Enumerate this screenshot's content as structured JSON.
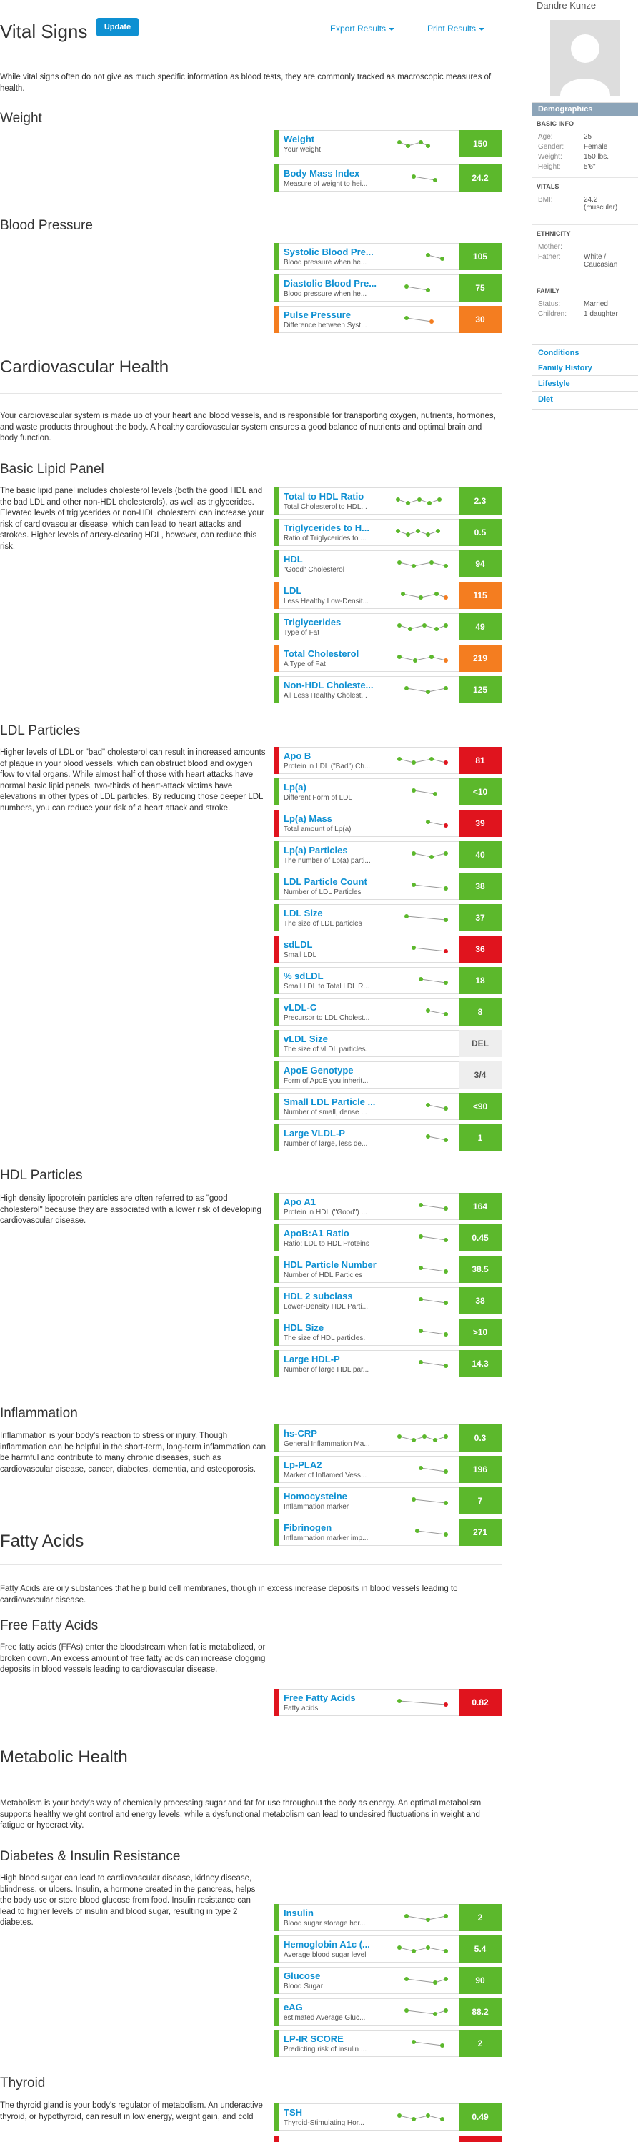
{
  "header": {
    "title": "Vital Signs",
    "update": "Update",
    "export": "Export Results",
    "print": "Print Results"
  },
  "intro": "While vital signs often do not give as much specific information as blood tests, they are commonly tracked as macroscopic measures of health.",
  "sidebar": {
    "name": "Dandre Kunze",
    "demographics": "Demographics",
    "basic_info": "BASIC INFO",
    "age_k": "Age:",
    "age_v": "25",
    "gender_k": "Gender:",
    "gender_v": "Female",
    "weight_k": "Weight:",
    "weight_v": "150 lbs.",
    "height_k": "Height:",
    "height_v": "5'6\"",
    "vitals": "VITALS",
    "bmi_k": "BMI:",
    "bmi_v": "24.2 (muscular)",
    "ethnicity": "ETHNICITY",
    "mother_k": "Mother:",
    "mother_v": "",
    "father_k": "Father:",
    "father_v": "White / Caucasian",
    "family": "FAMILY",
    "status_k": "Status:",
    "status_v": "Married",
    "children_k": "Children:",
    "children_v": "1 daughter",
    "nav": [
      "Conditions",
      "Family History",
      "Lifestyle",
      "Diet"
    ]
  },
  "sections": {
    "weight": "Weight",
    "bp": "Blood Pressure",
    "cardio": "Cardiovascular Health",
    "cardio_text": "Your cardiovascular system is made up of your heart and blood vessels, and is responsible for transporting oxygen, nutrients, hormones, and waste products throughout the body. A healthy cardiovascular system ensures a good balance of nutrients and optimal brain and body function.",
    "lipid": "Basic Lipid Panel",
    "lipid_text": "The basic lipid panel includes cholesterol levels (both the good HDL and the bad LDL and other non-HDL cholesterols), as well as triglycerides. Elevated levels of triglycerides or non-HDL cholesterol can increase your risk of cardiovascular disease, which can lead to heart attacks and strokes. Higher levels of artery-clearing HDL, however, can reduce this risk.",
    "ldl": "LDL Particles",
    "ldl_text": "Higher levels of LDL or \"bad\" cholesterol can result in increased amounts of plaque in your blood vessels, which can obstruct blood and oxygen flow to vital organs. While almost half of those with heart attacks have normal basic lipid panels, two-thirds of heart-attack victims have elevations in other types of LDL particles. By reducing those deeper LDL numbers, you can reduce your risk of a heart attack and stroke.",
    "hdl": "HDL Particles",
    "hdl_text": "High density lipoprotein particles are often referred to as \"good cholesterol\" because they are associated with a lower risk of developing cardiovascular disease.",
    "infl": "Inflammation",
    "infl_text": "Inflammation is your body's reaction to stress or injury. Though inflammation can be helpful in the short-term, long-term inflammation can be harmful and contribute to many chronic diseases, such as cardiovascular disease, cancer, diabetes, dementia, and osteoporosis.",
    "fatty": "Fatty Acids",
    "fatty_text": "Fatty Acids are oily substances that help build cell membranes, though in excess increase deposits in blood vessels leading to cardiovascular disease.",
    "ffa": "Free Fatty Acids",
    "ffa_text": "Free fatty acids (FFAs) enter the bloodstream when fat is metabolized, or broken down. An excess amount of free fatty acids can increase clogging deposits in blood vessels leading to cardiovascular disease.",
    "metab": "Metabolic Health",
    "metab_text": "Metabolism is your body's way of chemically processing sugar and fat for use throughout the body as energy. An optimal metabolism supports healthy weight control and energy levels, while a dysfunctional metabolism can lead to undesired fluctuations in weight and fatigue or hyperactivity.",
    "diab": "Diabetes & Insulin Resistance",
    "diab_text": "High blood sugar can lead to cardiovascular disease, kidney disease, blindness, or ulcers. Insulin, a hormone created in the pancreas, helps the body use or store blood glucose from food. Insulin resistance can lead to higher levels of insulin and blood sugar, resulting in type 2 diabetes.",
    "thyroid": "Thyroid",
    "thyroid_text": "The thyroid gland is your body's regulator of metabolism. An underactive thyroid, or hypothyroid, can result in low energy, weight gain, and cold"
  },
  "rows": [
    {
      "name": "Weight",
      "desc": "Your weight",
      "value": "150",
      "color": "g",
      "status": "normal"
    },
    {
      "name": "Body Mass Index",
      "desc": "Measure of weight to hei...",
      "value": "24.2",
      "color": "g",
      "status": "normal"
    },
    {
      "name": "Systolic Blood Pre...",
      "desc": "Blood pressure when he...",
      "value": "105",
      "color": "g",
      "status": "normal"
    },
    {
      "name": "Diastolic Blood Pre...",
      "desc": "Blood pressure when he...",
      "value": "75",
      "color": "g",
      "status": "normal"
    },
    {
      "name": "Pulse Pressure",
      "desc": "Difference between Syst...",
      "value": "30",
      "color": "o",
      "status": "borderline"
    },
    {
      "name": "Total to HDL Ratio",
      "desc": "Total Cholesterol to HDL...",
      "value": "2.3",
      "color": "g",
      "status": "normal"
    },
    {
      "name": "Triglycerides to H...",
      "desc": "Ratio of Triglycerides to ...",
      "value": "0.5",
      "color": "g",
      "status": "normal"
    },
    {
      "name": "HDL",
      "desc": "\"Good\" Cholesterol",
      "value": "94",
      "color": "g",
      "status": "normal"
    },
    {
      "name": "LDL",
      "desc": "Less Healthy Low-Densit...",
      "value": "115",
      "color": "o",
      "status": "borderline"
    },
    {
      "name": "Triglycerides",
      "desc": "Type of Fat",
      "value": "49",
      "color": "g",
      "status": "normal"
    },
    {
      "name": "Total Cholesterol",
      "desc": "A Type of Fat",
      "value": "219",
      "color": "o",
      "status": "borderline"
    },
    {
      "name": "Non-HDL Choleste...",
      "desc": "All Less Healthy Cholest...",
      "value": "125",
      "color": "g",
      "status": "normal"
    },
    {
      "name": "Apo B",
      "desc": "Protein in LDL (\"Bad\") Ch...",
      "value": "81",
      "color": "r",
      "status": "high"
    },
    {
      "name": "Lp(a)",
      "desc": "Different Form of LDL",
      "value": "<10",
      "color": "g",
      "status": "normal"
    },
    {
      "name": "Lp(a) Mass",
      "desc": "Total amount of Lp(a)",
      "value": "39",
      "color": "r",
      "status": "high"
    },
    {
      "name": "Lp(a) Particles",
      "desc": "The number of Lp(a) parti...",
      "value": "40",
      "color": "g",
      "status": "normal"
    },
    {
      "name": "LDL Particle Count",
      "desc": "Number of LDL Particles",
      "value": "38",
      "color": "g",
      "status": "normal"
    },
    {
      "name": "LDL Size",
      "desc": "The size of LDL particles",
      "value": "37",
      "color": "g",
      "status": "normal"
    },
    {
      "name": "sdLDL",
      "desc": "Small LDL",
      "value": "36",
      "color": "r",
      "status": "high"
    },
    {
      "name": "% sdLDL",
      "desc": "Small LDL to Total LDL R...",
      "value": "18",
      "color": "g",
      "status": "normal"
    },
    {
      "name": "vLDL-C",
      "desc": "Precursor to LDL Cholest...",
      "value": "8",
      "color": "g",
      "status": "normal"
    },
    {
      "name": "vLDL Size",
      "desc": "The size of vLDL particles.",
      "value": "DEL",
      "color": "n",
      "status": "none"
    },
    {
      "name": "ApoE Genotype",
      "desc": "Form of ApoE you inherit...",
      "value": "3/4",
      "color": "n",
      "status": "none"
    },
    {
      "name": "Small LDL Particle ...",
      "desc": "Number of small, dense ...",
      "value": "<90",
      "color": "g",
      "status": "normal"
    },
    {
      "name": "Large VLDL-P",
      "desc": "Number of large, less de...",
      "value": "1",
      "color": "g",
      "status": "normal"
    },
    {
      "name": "Apo A1",
      "desc": "Protein in HDL (\"Good\") ...",
      "value": "164",
      "color": "g",
      "status": "normal"
    },
    {
      "name": "ApoB:A1 Ratio",
      "desc": "Ratio: LDL to HDL Proteins",
      "value": "0.45",
      "color": "g",
      "status": "normal"
    },
    {
      "name": "HDL Particle Number",
      "desc": "Number of HDL Particles",
      "value": "38.5",
      "color": "g",
      "status": "normal"
    },
    {
      "name": "HDL 2 subclass",
      "desc": "Lower-Density HDL Parti...",
      "value": "38",
      "color": "g",
      "status": "normal"
    },
    {
      "name": "HDL Size",
      "desc": "The size of HDL particles.",
      "value": ">10",
      "color": "g",
      "status": "normal"
    },
    {
      "name": "Large HDL-P",
      "desc": "Number of large HDL par...",
      "value": "14.3",
      "color": "g",
      "status": "normal"
    },
    {
      "name": "hs-CRP",
      "desc": "General Inflammation Ma...",
      "value": "0.3",
      "color": "g",
      "status": "normal"
    },
    {
      "name": "Lp-PLA2",
      "desc": "Marker of Inflamed Vess...",
      "value": "196",
      "color": "g",
      "status": "normal"
    },
    {
      "name": "Homocysteine",
      "desc": "Inflammation marker",
      "value": "7",
      "color": "g",
      "status": "normal"
    },
    {
      "name": "Fibrinogen",
      "desc": "Inflammation marker imp...",
      "value": "271",
      "color": "g",
      "status": "normal"
    },
    {
      "name": "Free Fatty Acids",
      "desc": "Fatty acids",
      "value": "0.82",
      "color": "r",
      "status": "high"
    },
    {
      "name": "Insulin",
      "desc": "Blood sugar storage hor...",
      "value": "2",
      "color": "g",
      "status": "normal"
    },
    {
      "name": "Hemoglobin A1c (...",
      "desc": "Average blood sugar level",
      "value": "5.4",
      "color": "g",
      "status": "normal"
    },
    {
      "name": "Glucose",
      "desc": "Blood Sugar",
      "value": "90",
      "color": "g",
      "status": "normal"
    },
    {
      "name": "eAG",
      "desc": "estimated Average Gluc...",
      "value": "88.2",
      "color": "g",
      "status": "normal"
    },
    {
      "name": "LP-IR SCORE",
      "desc": "Predicting risk of insulin ...",
      "value": "2",
      "color": "g",
      "status": "normal"
    },
    {
      "name": "TSH",
      "desc": "Thyroid-Stimulating Hor...",
      "value": "0.49",
      "color": "g",
      "status": "normal"
    },
    {
      "name": "",
      "desc": "",
      "value": "",
      "color": "r",
      "status": "high"
    }
  ]
}
